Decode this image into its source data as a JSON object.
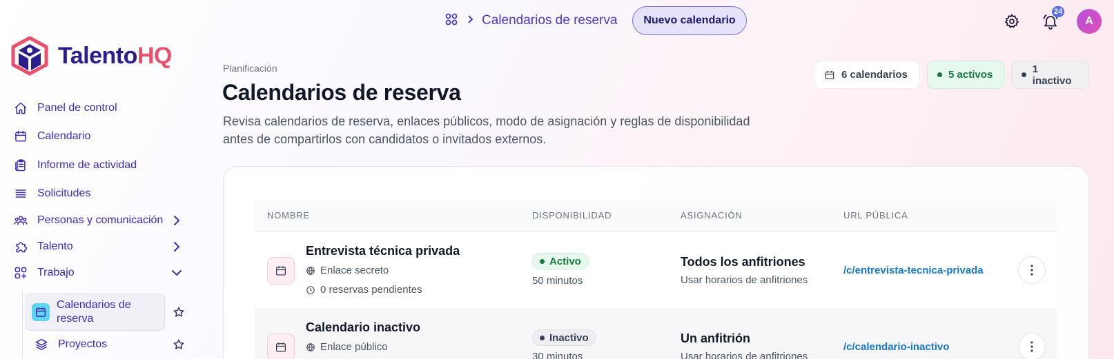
{
  "brand": {
    "name_part1": "Talento",
    "name_part2": "HQ",
    "color_primary": "#2a1d8c",
    "color_accent": "#e8506c"
  },
  "sidebar": {
    "items": [
      {
        "label": "Panel de control",
        "icon": "home-icon"
      },
      {
        "label": "Calendario",
        "icon": "calendar-icon"
      },
      {
        "label": "Informe de actividad",
        "icon": "clipboard-icon"
      },
      {
        "label": "Solicitudes",
        "icon": "list-icon"
      },
      {
        "label": "Personas y comunicación",
        "icon": "people-icon",
        "expandable": true
      },
      {
        "label": "Talento",
        "icon": "puzzle-icon",
        "expandable": true
      },
      {
        "label": "Trabajo",
        "icon": "apps-add-icon",
        "expanded": true
      }
    ],
    "sub_items": [
      {
        "label": "Calendarios de reserva",
        "icon": "calendar-icon",
        "active": true
      },
      {
        "label": "Proyectos",
        "icon": "layers-icon"
      }
    ]
  },
  "topbar": {
    "breadcrumb_current": "Calendarios de reserva",
    "new_button_label": "Nuevo calendario",
    "notification_count": "24",
    "avatar_initial": "A"
  },
  "header": {
    "eyebrow": "Planificación",
    "title": "Calendarios de reserva",
    "description": "Revisa calendarios de reserva, enlaces públicos, modo de asignación y reglas de disponibilidad antes de compartirlos con candidatos o invitados externos."
  },
  "summary": {
    "total": "6 calendarios",
    "active": "5 activos",
    "inactive": "1 inactivo",
    "color_active": "#167a3e"
  },
  "table": {
    "columns": [
      "NOMBRE",
      "DISPONIBILIDAD",
      "ASIGNACIÓN",
      "URL PÚBLICA"
    ],
    "rows": [
      {
        "name": "Entrevista técnica privada",
        "link_type": "Enlace secreto",
        "pending": "0 reservas pendientes",
        "status": "Activo",
        "duration": "50 minutos",
        "assignment": "Todos los anfitriones",
        "assignment_detail": "Usar horarios de anfitriones",
        "url": "/c/entrevista-tecnica-privada"
      },
      {
        "name": "Calendario inactivo",
        "link_type": "Enlace público",
        "status": "Inactivo",
        "duration": "30 minutos",
        "assignment": "Un anfitrión",
        "assignment_detail": "Usar horarios de anfitriones",
        "url": "/c/calendario-inactivo"
      }
    ]
  }
}
